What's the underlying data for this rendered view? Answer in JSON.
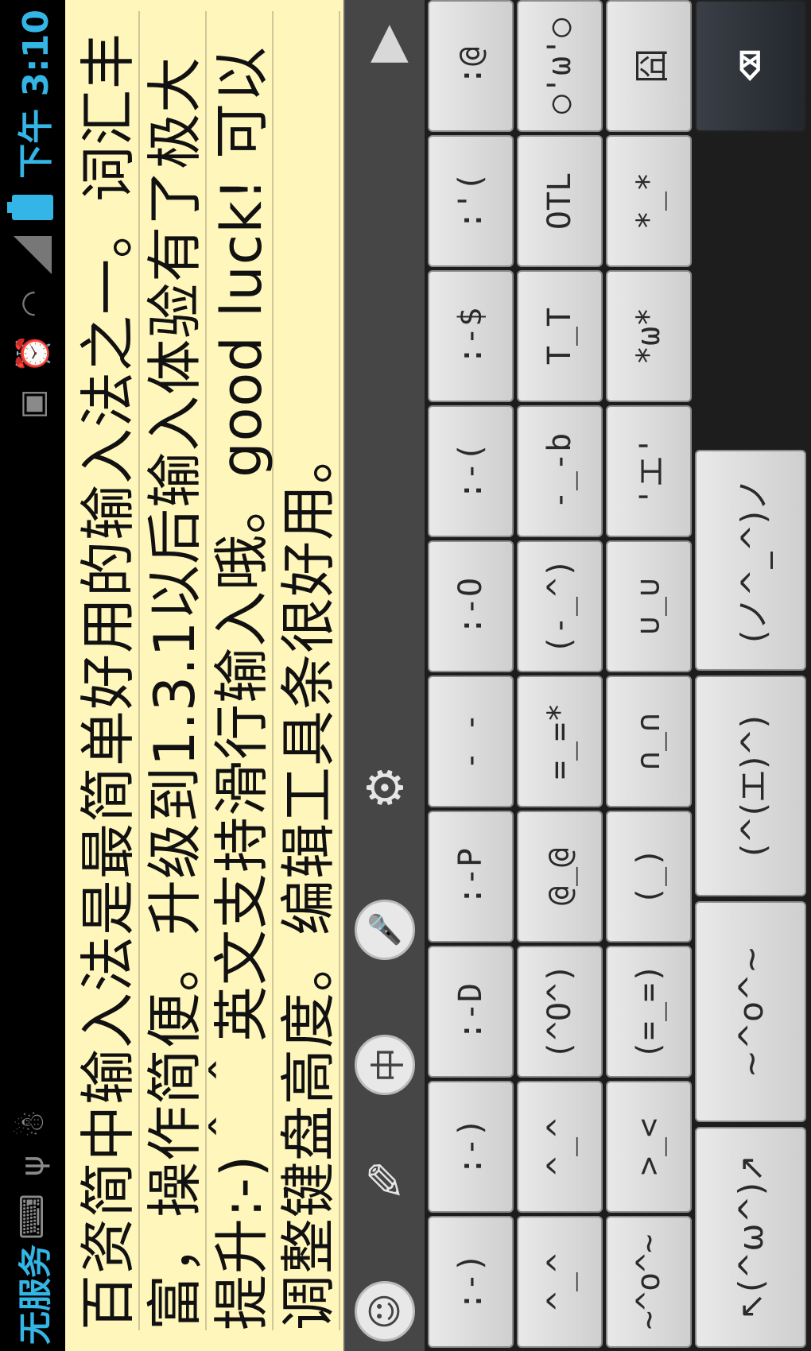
{
  "status_bar": {
    "carrier": "无服务",
    "time": "下午 3:10",
    "left_icons": [
      "keyboard-icon",
      "usb-icon",
      "android-icon"
    ],
    "right_icons": [
      "sim-icon",
      "alarm-icon",
      "wifi-icon",
      "signal-icon",
      "battery-icon"
    ]
  },
  "editor": {
    "text": "百资简中输入法是最简单好用的输入法之一。词汇丰富，操作简便。升级到1.3.1以后输入体验有了极大提升:-)＾＾英文支持滑行输入哦。good luck! 可以调整键盘高度。编辑工具条很好用。"
  },
  "toolbar": {
    "items": [
      {
        "name": "emoticon",
        "glyph": "☺"
      },
      {
        "name": "handwriting",
        "glyph": "✎"
      },
      {
        "name": "chinese-mode",
        "glyph": "中"
      },
      {
        "name": "voice",
        "glyph": "🎤"
      },
      {
        "name": "settings",
        "glyph": "⚙"
      },
      {
        "name": "collapse",
        "glyph": "▶"
      }
    ]
  },
  "emoticons": {
    "rows": [
      [
        ":-)",
        ":-)",
        ":-D",
        ":-P",
        "- -",
        ":-O",
        ":-(",
        ":-$",
        ":'(",
        ":@"
      ],
      [
        "^_^",
        "^_^",
        "(^O^)",
        "@_@",
        "=_=*",
        "(-_^)",
        "-_-b",
        "T_T",
        "OTL",
        "○'ω'○"
      ],
      [
        "~^o^~",
        ">_<",
        "(=_=)",
        "(_)",
        "∩_∩",
        "∪_∪",
        "'エ'",
        "*ω*",
        "*_*",
        "囧"
      ]
    ],
    "bottom_row": [
      "↖(^ω^)↗",
      "~^o^~",
      "(^(エ)^)",
      "(ノ^_^)ノ"
    ],
    "delete_glyph": "⌫"
  }
}
